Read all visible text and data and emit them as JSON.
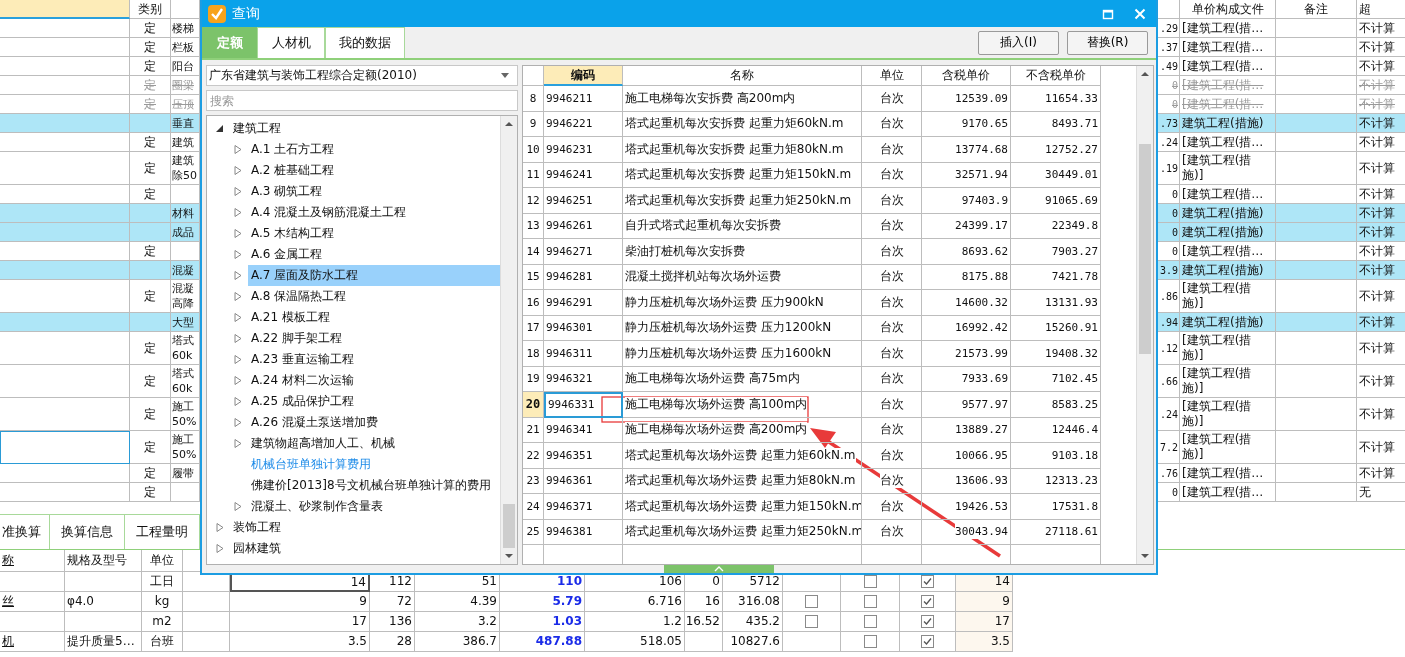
{
  "main_grid": {
    "columns": {
      "type": "类别",
      "cost_file": "单价构成文件",
      "note": "备注",
      "super_high": "超"
    },
    "rows": [
      {
        "kind": "item",
        "type": "定",
        "name": "楼梯",
        "price": ".29",
        "cost_file": "[建筑工程(措…",
        "super_high": "不计算",
        "struck": false,
        "selected": false
      },
      {
        "kind": "item",
        "type": "定",
        "name": "栏板",
        "price": ".37",
        "cost_file": "[建筑工程(措…",
        "super_high": "不计算",
        "struck": false,
        "selected": false
      },
      {
        "kind": "item",
        "type": "定",
        "name": "阳台",
        "price": ".49",
        "cost_file": "[建筑工程(措…",
        "super_high": "不计算",
        "struck": false,
        "selected": false
      },
      {
        "kind": "item",
        "type": "定",
        "name": "圈梁",
        "price": "0",
        "cost_file": "[建筑工程(措…",
        "super_high": "不计算",
        "struck": true,
        "selected": false
      },
      {
        "kind": "item",
        "type": "定",
        "name": "压顶",
        "price": "0",
        "cost_file": "[建筑工程(措…",
        "super_high": "不计算",
        "struck": true,
        "selected": false
      },
      {
        "kind": "group",
        "name": "垂直",
        "price": ".73",
        "cost_file": "建筑工程(措施)",
        "super_high": "不计算",
        "struck": false,
        "selected": false
      },
      {
        "kind": "item",
        "type": "定",
        "name": "建筑",
        "price": ".24",
        "cost_file": "[建筑工程(措…",
        "super_high": "不计算",
        "struck": false,
        "selected": false
      },
      {
        "kind": "item",
        "type": "定",
        "name": "建筑除50",
        "price": ".19",
        "cost_file": "[建筑工程(措施)]",
        "super_high": "不计算",
        "struck": false,
        "selected": false
      },
      {
        "kind": "item",
        "type": "定",
        "price": "0",
        "cost_file": "[建筑工程(措…",
        "super_high": "不计算",
        "struck": false,
        "selected": false
      },
      {
        "kind": "group",
        "name": "材料",
        "price": "0",
        "cost_file": "建筑工程(措施)",
        "super_high": "不计算",
        "struck": false,
        "selected": false
      },
      {
        "kind": "group",
        "name": "成品",
        "price": "0",
        "cost_file": "建筑工程(措施)",
        "super_high": "不计算",
        "struck": false,
        "selected": false
      },
      {
        "kind": "item",
        "type": "定",
        "price": "0",
        "cost_file": "[建筑工程(措…",
        "super_high": "不计算",
        "struck": false,
        "selected": false
      },
      {
        "kind": "group",
        "name": "混凝",
        "price": "3.9",
        "cost_file": "建筑工程(措施)",
        "super_high": "不计算",
        "struck": false,
        "selected": false
      },
      {
        "kind": "item",
        "type": "定",
        "name": "混凝高降",
        "price": ".86",
        "cost_file": "[建筑工程(措施)]",
        "super_high": "不计算",
        "struck": false,
        "selected": false
      },
      {
        "kind": "group",
        "name": "大型",
        "price": ".94",
        "cost_file": "建筑工程(措施)",
        "super_high": "不计算",
        "struck": false,
        "selected": false
      },
      {
        "kind": "item",
        "type": "定",
        "name": "塔式60k",
        "price": ".12",
        "cost_file": "[建筑工程(措施)]",
        "super_high": "不计算",
        "struck": false,
        "selected": false
      },
      {
        "kind": "item",
        "type": "定",
        "name": "塔式60k",
        "price": ".66",
        "cost_file": "[建筑工程(措施)]",
        "super_high": "不计算",
        "struck": false,
        "selected": false
      },
      {
        "kind": "item",
        "type": "定",
        "name": "施工50%",
        "price": ".24",
        "cost_file": "[建筑工程(措施)]",
        "super_high": "不计算",
        "struck": false,
        "selected": false
      },
      {
        "kind": "item",
        "type": "定",
        "name": "施工50%",
        "price": "7.2",
        "cost_file": "[建筑工程(措施)]",
        "super_high": "不计算",
        "struck": false,
        "selected": true
      },
      {
        "kind": "item",
        "type": "定",
        "name": "履带",
        "price": ".76",
        "cost_file": "[建筑工程(措…",
        "super_high": "不计算",
        "struck": false,
        "selected": false
      },
      {
        "kind": "item",
        "type": "定",
        "price": "0",
        "cost_file": "[建筑工程(措…",
        "super_high": "无",
        "struck": false,
        "selected": false
      }
    ]
  },
  "bottom_tabs": [
    {
      "label": "准换算"
    },
    {
      "label": "换算信息"
    },
    {
      "label": "工程量明"
    }
  ],
  "detail_grid": {
    "columns": {
      "name": "称",
      "spec": "规格及型号",
      "unit": "单位"
    },
    "rows": [
      {
        "unit": "工日",
        "content": "14",
        "qty": "112",
        "quota_price": "51",
        "market_price": "110",
        "tax_market_price": "106",
        "tax_rate": "0",
        "total": "5712",
        "locked": false,
        "priced": true,
        "original": "14",
        "selected": true
      },
      {
        "name": "丝",
        "spec": "φ4.0",
        "unit": "kg",
        "content": "9",
        "qty": "72",
        "quota_price": "4.39",
        "market_price": "5.79",
        "tax_market_price": "6.716",
        "tax_rate": "16",
        "total": "316.08",
        "provisional": false,
        "locked": false,
        "priced": true,
        "original": "9",
        "selected": false
      },
      {
        "unit": "m2",
        "content": "17",
        "qty": "136",
        "quota_price": "3.2",
        "market_price": "1.03",
        "tax_market_price": "1.2",
        "tax_rate": "16.52",
        "total": "435.2",
        "provisional": false,
        "locked": false,
        "priced": true,
        "original": "17",
        "selected": false
      },
      {
        "name": "机",
        "spec": "提升质量5…",
        "unit": "台班",
        "content": "3.5",
        "qty": "28",
        "quota_price": "386.7",
        "market_price": "487.88",
        "tax_market_price": "518.05",
        "total": "10827.6",
        "locked": false,
        "priced": true,
        "original": "3.5",
        "selected": false
      }
    ]
  },
  "dialog": {
    "title": "查询",
    "tabs": [
      {
        "label": "定额",
        "selected": true
      },
      {
        "label": "人材机",
        "selected": false
      },
      {
        "label": "我的数据",
        "selected": false
      }
    ],
    "buttons": [
      "插入(I)",
      "替换(R)"
    ],
    "library": "广东省建筑与装饰工程综合定额(2010)",
    "search": {
      "placeholder": "搜索"
    },
    "tree": [
      {
        "label": "建筑工程",
        "expanded": true,
        "selected": false,
        "hover": false,
        "children": [
          {
            "label": "A.1 土石方工程",
            "expanded": false,
            "selected": false,
            "hover": false
          },
          {
            "label": "A.2 桩基础工程",
            "expanded": false,
            "selected": false,
            "hover": false
          },
          {
            "label": "A.3 砌筑工程",
            "expanded": false,
            "selected": false,
            "hover": false
          },
          {
            "label": "A.4 混凝土及钢筋混凝土工程",
            "expanded": false,
            "selected": false,
            "hover": false
          },
          {
            "label": "A.5 木结构工程",
            "expanded": false,
            "selected": false,
            "hover": false
          },
          {
            "label": "A.6 金属工程",
            "expanded": false,
            "selected": false,
            "hover": false
          },
          {
            "label": "A.7 屋面及防水工程",
            "expanded": false,
            "selected": true,
            "hover": false
          },
          {
            "label": "A.8 保温隔热工程",
            "expanded": false,
            "selected": false,
            "hover": false
          },
          {
            "label": "A.21 模板工程",
            "expanded": false,
            "selected": false,
            "hover": false
          },
          {
            "label": "A.22 脚手架工程",
            "expanded": false,
            "selected": false,
            "hover": false
          },
          {
            "label": "A.23 垂直运输工程",
            "expanded": false,
            "selected": false,
            "hover": false
          },
          {
            "label": "A.24 材料二次运输",
            "expanded": false,
            "selected": false,
            "hover": false
          },
          {
            "label": "A.25 成品保护工程",
            "expanded": false,
            "selected": false,
            "hover": false
          },
          {
            "label": "A.26 混凝土泵送增加费",
            "expanded": false,
            "selected": false,
            "hover": false
          },
          {
            "label": "建筑物超高增加人工、机械",
            "expanded": false,
            "selected": false,
            "hover": false
          },
          {
            "label": "机械台班单独计算费用",
            "selected": false,
            "hover": true
          },
          {
            "label": "佛建价[2013]8号文机械台班单独计算的费用",
            "selected": false,
            "hover": false
          },
          {
            "label": "混凝土、砂浆制作含量表",
            "expanded": false,
            "selected": false,
            "hover": false
          }
        ]
      },
      {
        "label": "装饰工程",
        "expanded": false,
        "selected": false,
        "hover": false
      },
      {
        "label": "园林建筑",
        "expanded": false,
        "selected": false,
        "hover": false
      }
    ],
    "table": {
      "columns": {
        "code": "编码",
        "name": "名称",
        "unit": "单位",
        "price_tax": "含税单价",
        "price": "不含税单价"
      },
      "rows": [
        {
          "no": "8",
          "code": "9946211",
          "name": "施工电梯每次安拆费 高200m内",
          "unit": "台次",
          "price_tax": "12539.09",
          "price": "11654.33",
          "selected": false
        },
        {
          "no": "9",
          "code": "9946221",
          "name": "塔式起重机每次安拆费 起重力矩60kN.m",
          "unit": "台次",
          "price_tax": "9170.65",
          "price": "8493.71",
          "selected": false
        },
        {
          "no": "10",
          "code": "9946231",
          "name": "塔式起重机每次安拆费 起重力矩80kN.m",
          "unit": "台次",
          "price_tax": "13774.68",
          "price": "12752.27",
          "selected": false
        },
        {
          "no": "11",
          "code": "9946241",
          "name": "塔式起重机每次安拆费 起重力矩150kN.m",
          "unit": "台次",
          "price_tax": "32571.94",
          "price": "30449.01",
          "selected": false
        },
        {
          "no": "12",
          "code": "9946251",
          "name": "塔式起重机每次安拆费 起重力矩250kN.m",
          "unit": "台次",
          "price_tax": "97403.9",
          "price": "91065.69",
          "selected": false
        },
        {
          "no": "13",
          "code": "9946261",
          "name": "自升式塔式起重机每次安拆费",
          "unit": "台次",
          "price_tax": "24399.17",
          "price": "22349.8",
          "selected": false
        },
        {
          "no": "14",
          "code": "9946271",
          "name": "柴油打桩机每次安拆费",
          "unit": "台次",
          "price_tax": "8693.62",
          "price": "7903.27",
          "selected": false
        },
        {
          "no": "15",
          "code": "9946281",
          "name": "混凝土搅拌机站每次场外运费",
          "unit": "台次",
          "price_tax": "8175.88",
          "price": "7421.78",
          "selected": false
        },
        {
          "no": "16",
          "code": "9946291",
          "name": "静力压桩机每次场外运费 压力900kN",
          "unit": "台次",
          "price_tax": "14600.32",
          "price": "13131.93",
          "selected": false
        },
        {
          "no": "17",
          "code": "9946301",
          "name": "静力压桩机每次场外运费 压力1200kN",
          "unit": "台次",
          "price_tax": "16992.42",
          "price": "15260.91",
          "selected": false
        },
        {
          "no": "18",
          "code": "9946311",
          "name": "静力压桩机每次场外运费 压力1600kN",
          "unit": "台次",
          "price_tax": "21573.99",
          "price": "19408.32",
          "selected": false
        },
        {
          "no": "19",
          "code": "9946321",
          "name": "施工电梯每次场外运费 高75m内",
          "unit": "台次",
          "price_tax": "7933.69",
          "price": "7102.45",
          "selected": false
        },
        {
          "no": "20",
          "code": "9946331",
          "name": "施工电梯每次场外运费 高100m内",
          "unit": "台次",
          "price_tax": "9577.97",
          "price": "8583.25",
          "selected": true
        },
        {
          "no": "21",
          "code": "9946341",
          "name": "施工电梯每次场外运费 高200m内",
          "unit": "台次",
          "price_tax": "13889.27",
          "price": "12446.4",
          "selected": false
        },
        {
          "no": "22",
          "code": "9946351",
          "name": "塔式起重机每次场外运费 起重力矩60kN.m",
          "unit": "台次",
          "price_tax": "10066.95",
          "price": "9103.18",
          "selected": false
        },
        {
          "no": "23",
          "code": "9946361",
          "name": "塔式起重机每次场外运费 起重力矩80kN.m",
          "unit": "台次",
          "price_tax": "13606.93",
          "price": "12313.23",
          "selected": false
        },
        {
          "no": "24",
          "code": "9946371",
          "name": "塔式起重机每次场外运费 起重力矩150kN.m",
          "unit": "台次",
          "price_tax": "19426.53",
          "price": "17531.8",
          "selected": false
        },
        {
          "no": "25",
          "code": "9946381",
          "name": "塔式起重机每次场外运费 起重力矩250kN.m",
          "unit": "台次",
          "price_tax": "30043.94",
          "price": "27118.61",
          "selected": false
        }
      ]
    }
  }
}
